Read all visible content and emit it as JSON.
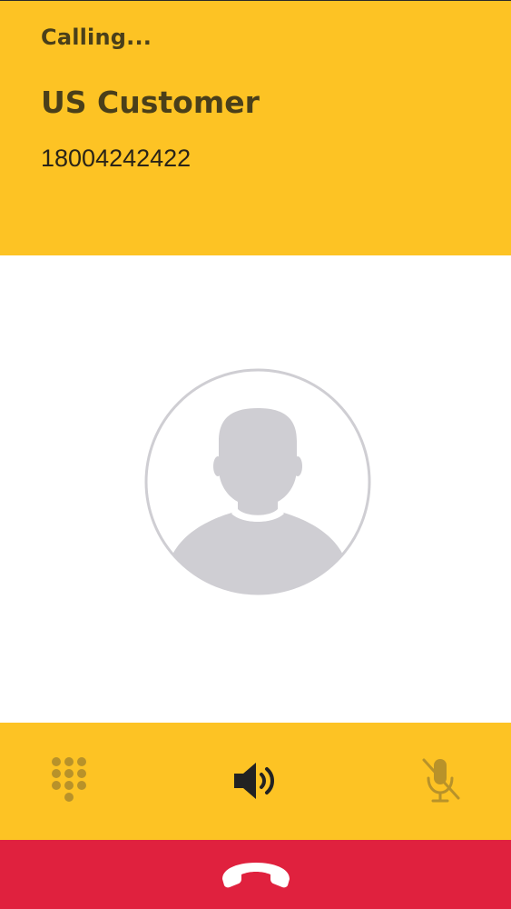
{
  "call": {
    "status": "Calling...",
    "contact_name": "US Customer",
    "phone_number": "18004242422"
  },
  "controls": {
    "dialpad_icon": "dialpad-icon",
    "speaker_icon": "speaker-icon",
    "mute_icon": "microphone-muted-icon",
    "end_call_icon": "phone-hangup-icon"
  },
  "colors": {
    "accent": "#fdc324",
    "end_call": "#e0213e",
    "text_dark": "#4a3f1a",
    "avatar_gray": "#cfced3"
  }
}
